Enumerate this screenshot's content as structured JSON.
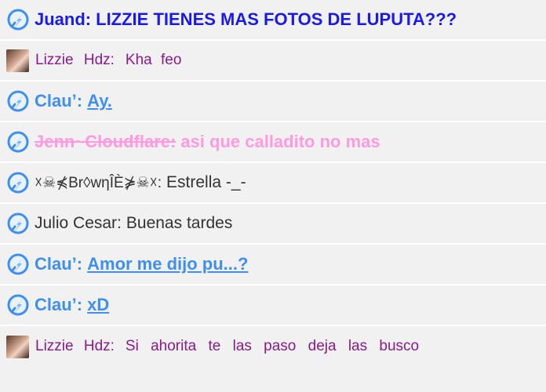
{
  "messages": [
    {
      "sender": "Juand:",
      "text": "LIZZIE TIENES MAS FOTOS DE LUPUTA???"
    },
    {
      "sender": "Lizzie  Hdz:",
      "text": "Kha  feo"
    },
    {
      "sender": "Clau’:",
      "text": "Ay."
    },
    {
      "sender": "Jenn~Cloudflare:",
      "text": "asi que calladito  no mas"
    },
    {
      "sender": "☓☠⋠Br◊wηÎÈ⋡☠☓:",
      "text": "Estrella -_-"
    },
    {
      "sender": "Julio Cesar:",
      "text": "Buenas tardes"
    },
    {
      "sender": "Clau’:",
      "text": "Amor me dijo pu...?"
    },
    {
      "sender": "Clau’:",
      "text": "xD"
    },
    {
      "sender": "Lizzie  Hdz:",
      "text": "Si  ahorita  te  las  paso  deja  las  busco"
    }
  ],
  "icons": {
    "bubble": "chat-bubble-icon",
    "avatar": "user-avatar"
  },
  "colors": {
    "background": "#f1f1f1",
    "separator": "#ffffff",
    "blue_dark": "#1a1aee",
    "blue": "#3f8ff0",
    "pink": "#ff9ae0",
    "purple": "#8a1a8a",
    "dark": "#333333"
  }
}
